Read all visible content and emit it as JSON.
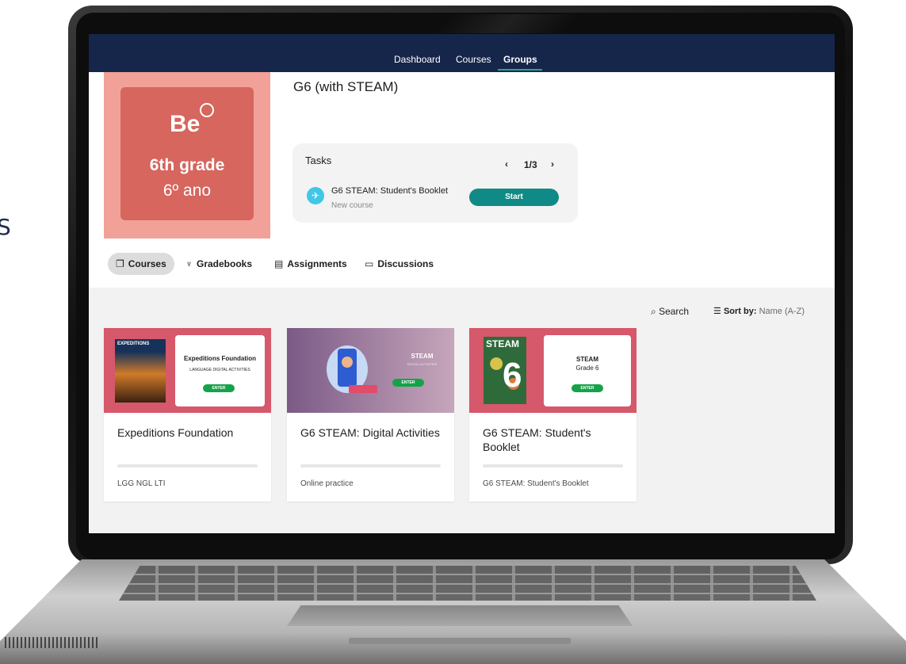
{
  "page_edge_text": "S",
  "nav": {
    "items": [
      {
        "label": "Dashboard",
        "active": false
      },
      {
        "label": "Courses",
        "active": false
      },
      {
        "label": "Groups",
        "active": true
      }
    ]
  },
  "group": {
    "tile": {
      "logo": "Be",
      "grade_en": "6th grade",
      "grade_pt": "6º ano"
    },
    "title": "G6 (with STEAM)"
  },
  "tasks": {
    "label": "Tasks",
    "pager": {
      "prev": "‹",
      "count": "1/3",
      "next": "›"
    },
    "item": {
      "name": "G6 STEAM: Student's Booklet",
      "subtitle": "New course",
      "action": "Start"
    }
  },
  "tabs": [
    {
      "label": "Courses",
      "icon": "copy-icon",
      "active": true
    },
    {
      "label": "Gradebooks",
      "icon": "trophy-icon",
      "active": false
    },
    {
      "label": "Assignments",
      "icon": "clipboard-icon",
      "active": false
    },
    {
      "label": "Discussions",
      "icon": "chat-icon",
      "active": false
    }
  ],
  "toolbar": {
    "search_label": "Search",
    "sort_label": "Sort by:",
    "sort_value": "Name (A-Z)"
  },
  "courses": [
    {
      "title": "Expeditions Foundation",
      "meta": "LGG NGL LTI",
      "cover": {
        "book": "EXPEDITIONS",
        "title": "Expeditions Foundation",
        "sub": "LANGUAGE DIGITAL ACTIVITIES",
        "button": "ENTER"
      }
    },
    {
      "title": "G6 STEAM: Digital Activities",
      "meta": "Online practice",
      "cover": {
        "title": "STEAM",
        "sub": "DIGITAL ACTIVITIES",
        "button": "ENTER"
      }
    },
    {
      "title": "G6 STEAM: Student's Booklet",
      "meta": "G6 STEAM: Student's Booklet",
      "cover": {
        "book_brand": "STEAM",
        "book_number": "6",
        "title": "STEAM",
        "sub": "Grade 6",
        "button": "ENTER"
      }
    }
  ],
  "colors": {
    "nav_bg": "#16264a",
    "accent_teal": "#0f8a86",
    "tile_outer": "#f2a198",
    "tile_inner": "#d6665e"
  }
}
